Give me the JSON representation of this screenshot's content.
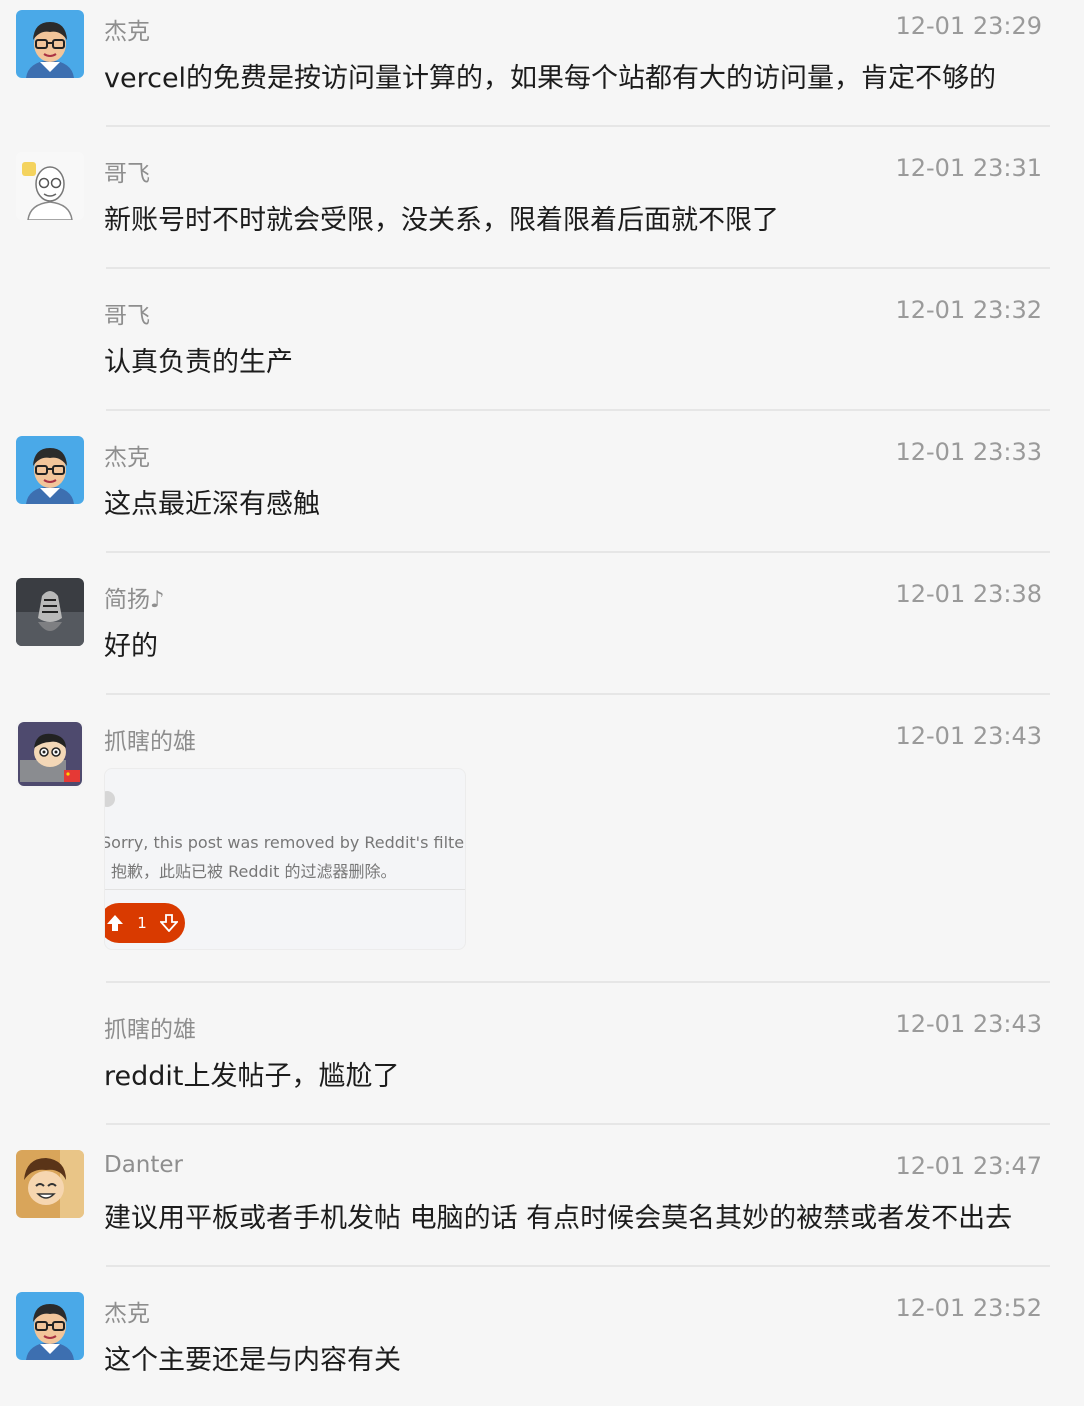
{
  "messages": [
    {
      "name": "杰克",
      "time": "12-01 23:29",
      "text": "vercel的免费是按访问量计算的，如果每个站都有大的访问量，肯定不够的",
      "avatar": "jack-avatar"
    },
    {
      "name": "哥飞",
      "time": "12-01 23:31",
      "text": "新账号时不时就会受限，没关系，限着限着后面就不限了",
      "avatar": "gefei-avatar"
    },
    {
      "name": "哥飞",
      "time": "12-01 23:32",
      "text": "认真负责的生产",
      "avatar": ""
    },
    {
      "name": "杰克",
      "time": "12-01 23:33",
      "text": "这点最近深有感触",
      "avatar": "jack-avatar"
    },
    {
      "name": "简扬♪",
      "time": "12-01 23:38",
      "text": "好的",
      "avatar": "tiger-avatar"
    },
    {
      "name": "抓瞎的雄",
      "time": "12-01 23:43",
      "avatar": "cartoon-avatar",
      "card": {
        "en": "Sorry, this post was removed by Reddit's filters.",
        "zh": "抱歉，此贴已被 Reddit 的过滤器删除。",
        "votes": "1"
      }
    },
    {
      "name": "抓瞎的雄",
      "time": "12-01 23:43",
      "text": "reddit上发帖子，尴尬了",
      "avatar": ""
    },
    {
      "name": "Danter",
      "time": "12-01 23:47",
      "text": "建议用平板或者手机发帖 电脑的话 有点时候会莫名其妙的被禁或者发不出去",
      "avatar": "anime-avatar"
    },
    {
      "name": "杰克",
      "time": "12-01 23:52",
      "text": "这个主要还是与内容有关",
      "avatar": "jack-avatar"
    }
  ],
  "colors": {
    "background": "#f6f6f6",
    "name": "#8e8e8e",
    "time": "#9a9a9a",
    "text": "#1c1c1c",
    "vote": "#d93a00"
  }
}
